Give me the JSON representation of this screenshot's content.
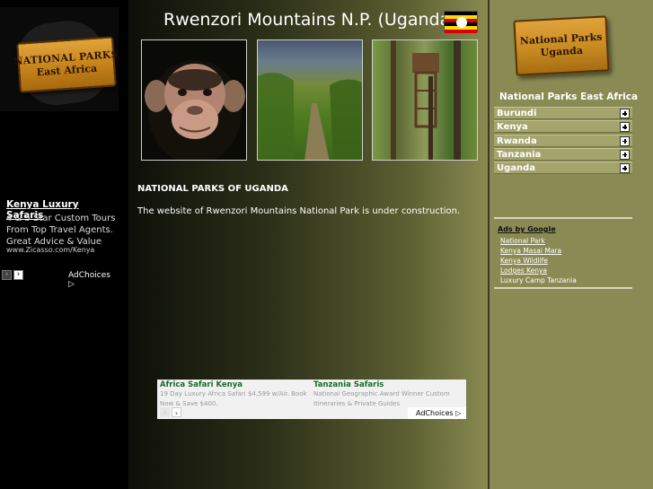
{
  "header": {
    "title": "Rwenzori Mountains N.P. (Uganda)",
    "flag_colors": [
      "#000000",
      "#fcdc04",
      "#d90000",
      "#000000",
      "#fcdc04",
      "#d90000"
    ]
  },
  "left_logo": {
    "line1": "NATIONAL PARKS",
    "line2": "East Africa"
  },
  "left_ad": {
    "title": "Kenya Luxury Safaris",
    "lines": [
      "4 & 5 Star Custom Tours",
      "From Top Travel Agents.",
      "Great Advice & Value"
    ],
    "url": "www.Zicasso.com/Kenya",
    "adchoices": "AdChoices ▷"
  },
  "photos": [
    {
      "name": "chimpanzee"
    },
    {
      "name": "forest-trail"
    },
    {
      "name": "treehouse"
    }
  ],
  "content": {
    "heading": "NATIONAL PARKS OF UGANDA",
    "text": "The website of Rwenzori Mountains National Park is under construction."
  },
  "bottom_ad": {
    "ads": [
      {
        "title": "Africa Safari Kenya",
        "desc": "19 Day Luxury Africa Safari $4,599 w/Air. Book Now & Save $400."
      },
      {
        "title": "Tanzania Safaris",
        "desc": "National Geographic Award Winner Custom Itineraries & Private Guides"
      }
    ],
    "adchoices": "AdChoices ▷"
  },
  "sidebar": {
    "logo": {
      "line1": "National Parks",
      "line2": "Uganda"
    },
    "title": "National Parks East Africa",
    "countries": [
      {
        "label": "Burundi"
      },
      {
        "label": "Kenya"
      },
      {
        "label": "Rwanda"
      },
      {
        "label": "Tanzania"
      },
      {
        "label": "Uganda"
      }
    ],
    "ads_label": "Ads by Google",
    "ad_links": [
      "National Park",
      "Kenya Masai Mara",
      "Kenya Wildlife",
      "Lodges Kenya",
      "Luxury Camp Tanzania"
    ]
  }
}
